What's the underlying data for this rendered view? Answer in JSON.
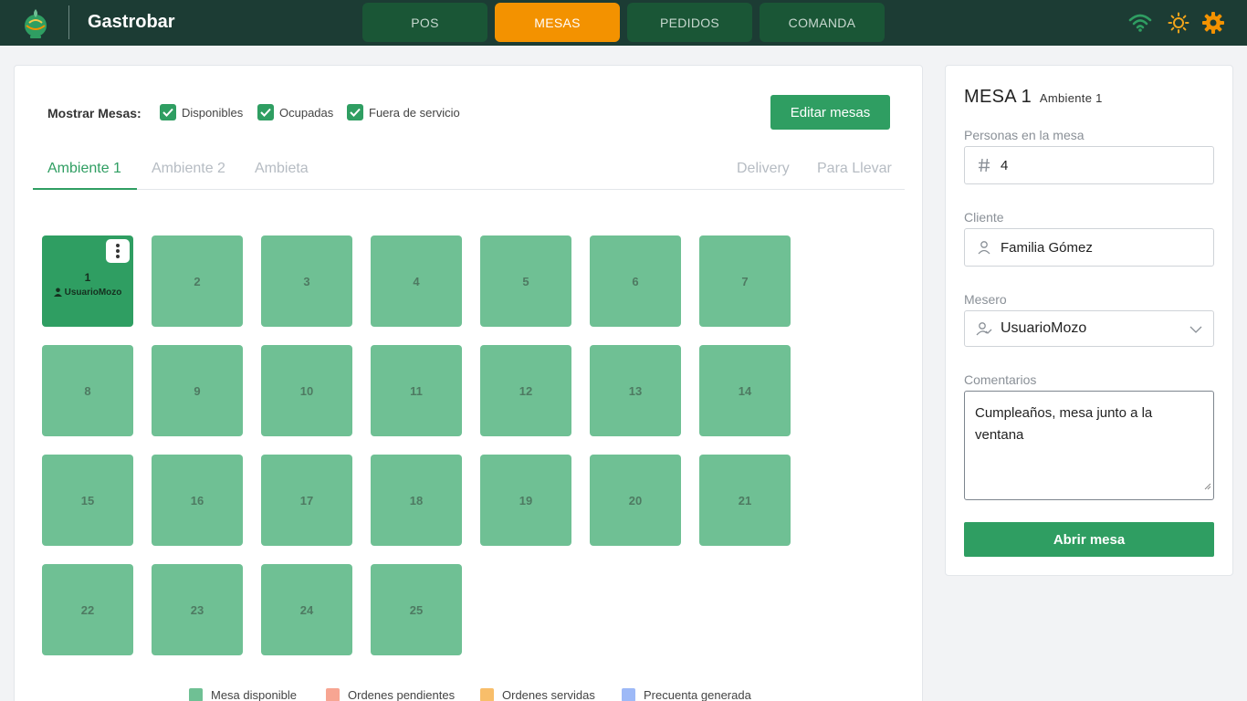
{
  "brand": {
    "name": "Gastrobar"
  },
  "nav": {
    "tabs": [
      {
        "label": "POS",
        "active": false
      },
      {
        "label": "MESAS",
        "active": true
      },
      {
        "label": "PEDIDOS",
        "active": false
      },
      {
        "label": "COMANDA",
        "active": false
      }
    ]
  },
  "topbar_icons": [
    "wifi-icon",
    "sun-icon",
    "gear-icon"
  ],
  "colors": {
    "topbar": "#1c3c34",
    "accent_green": "#2f9e62",
    "active_tab": "#f39200",
    "tile_available": "#6fc094"
  },
  "filters": {
    "label": "Mostrar Mesas:",
    "options": [
      {
        "label": "Disponibles",
        "checked": true
      },
      {
        "label": "Ocupadas",
        "checked": true
      },
      {
        "label": "Fuera de servicio",
        "checked": true
      }
    ],
    "edit_button": "Editar mesas"
  },
  "area_tabs": [
    {
      "label": "Ambiente 1",
      "active": true
    },
    {
      "label": "Ambiente 2",
      "active": false
    },
    {
      "label": "Ambieta",
      "active": false
    },
    {
      "label": "Delivery",
      "active": false
    },
    {
      "label": "Para Llevar",
      "active": false
    }
  ],
  "tables": [
    "1",
    "2",
    "3",
    "4",
    "5",
    "6",
    "7",
    "8",
    "9",
    "10",
    "11",
    "12",
    "13",
    "14",
    "15",
    "16",
    "17",
    "18",
    "19",
    "20",
    "21",
    "22",
    "23",
    "24",
    "25"
  ],
  "selected_table": {
    "number": "1",
    "waiter": "UsuarioMozo"
  },
  "legend": [
    {
      "label": "Mesa disponible",
      "color": "#6fc094"
    },
    {
      "label": "Ordenes pendientes",
      "color": "#f7a592"
    },
    {
      "label": "Ordenes servidas",
      "color": "#f8be6a"
    },
    {
      "label": "Precuenta generada",
      "color": "#9db9f7"
    }
  ],
  "panel": {
    "title": "MESA 1",
    "subtitle": "Ambiente 1",
    "people_label": "Personas en la mesa",
    "people_value": "4",
    "client_label": "Cliente",
    "client_value": "Familia Gómez",
    "waiter_label": "Mesero",
    "waiter_value": "UsuarioMozo",
    "comments_label": "Comentarios",
    "comments_value": "Cumpleaños, mesa junto a la ventana",
    "open_button": "Abrir mesa"
  }
}
